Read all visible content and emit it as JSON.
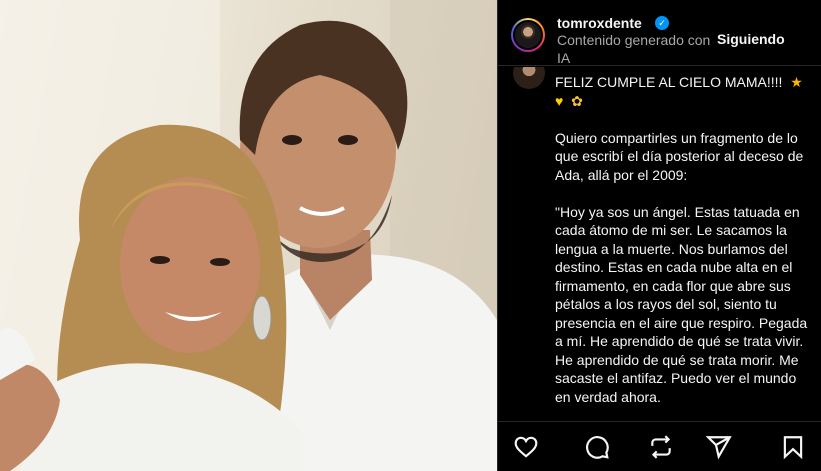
{
  "post": {
    "username": "tomroxdente",
    "ai_label": "Contenido generado con IA",
    "follow_label": "Siguiendo",
    "caption": {
      "headline": "FELIZ CUMPLE AL CIELO MAMA!!!!",
      "paragraph1": "Quiero compartirles un fragmento de lo que escribí el día posterior al deceso de Ada, allá por el 2009:",
      "paragraph2": "\"Hoy ya sos un ángel. Estas tatuada en cada átomo de mi ser. Le sacamos la lengua a la muerte. Nos burlamos del destino. Estas en cada nube alta en el firmamento, en cada flor que abre sus pétalos a los rayos del sol, siento tu presencia en el aire que respiro. Pegada a mí. He aprendido de qué se trata vivir. He aprendido de qué se trata morir. Me sacaste el antifaz. Puedo ver el mundo en verdad ahora."
    },
    "icons": {
      "verified": "verified-badge-icon",
      "like": "heart-icon",
      "comment": "comment-icon",
      "repost": "repost-icon",
      "share": "send-icon",
      "save": "bookmark-icon"
    },
    "colors": {
      "verified": "#0095f6",
      "background": "#000000",
      "secondary_text": "#a8a8a8"
    }
  }
}
